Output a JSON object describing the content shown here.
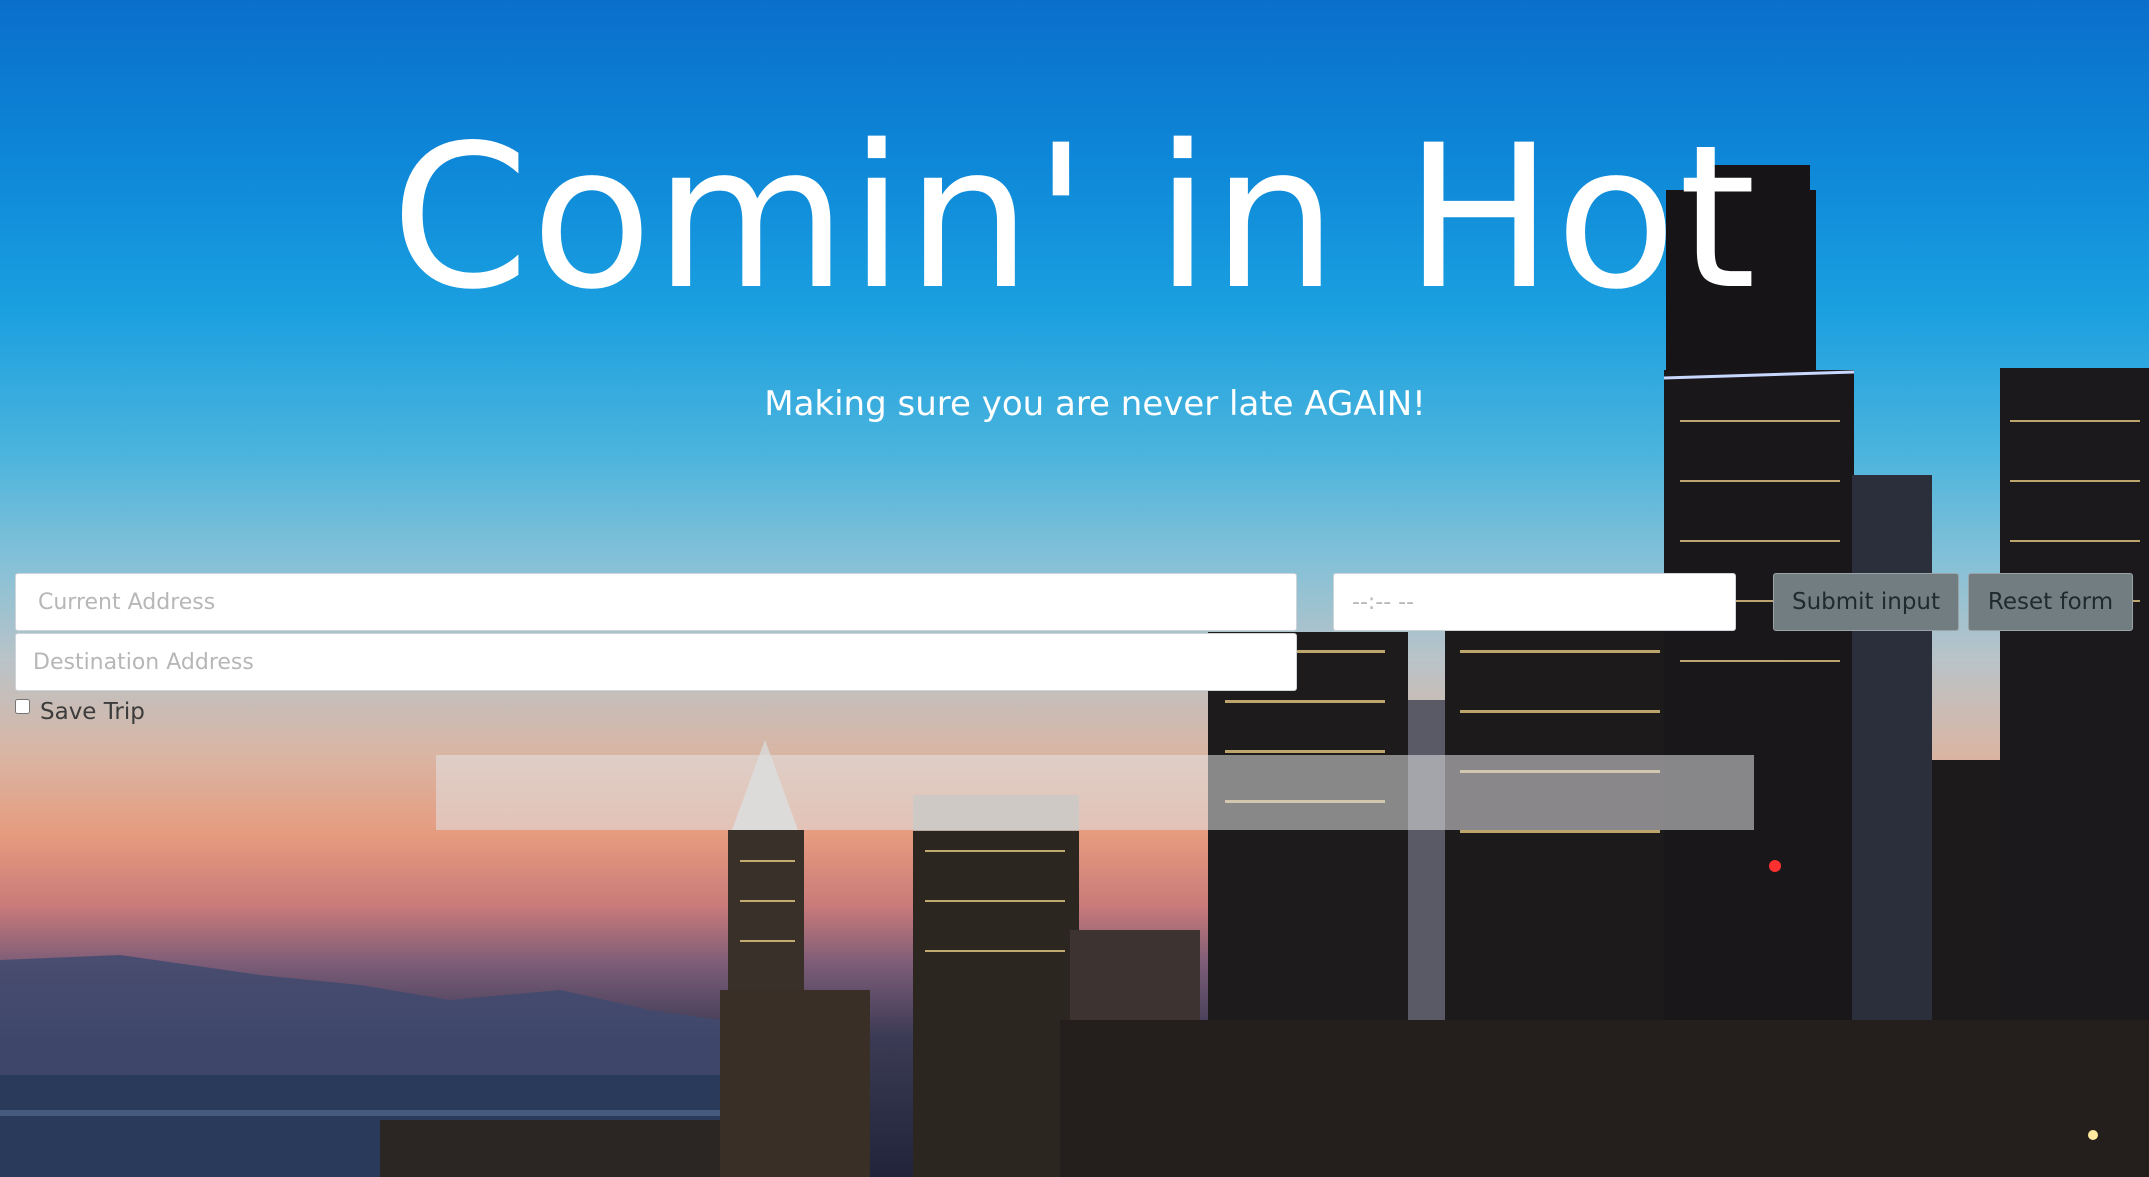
{
  "hero": {
    "title": "Comin' in Hot",
    "subtitle": "Making sure you are never late AGAIN!"
  },
  "form": {
    "current_address": {
      "placeholder": "Current Address",
      "value": ""
    },
    "destination_address": {
      "placeholder": "Destination Address",
      "value": ""
    },
    "time": {
      "value": "",
      "display": "--:-- --"
    },
    "submit_label": "Submit input",
    "reset_label": "Reset form",
    "save_trip_label": "Save Trip",
    "save_trip_checked": false
  },
  "result": {
    "text": ""
  },
  "colors": {
    "button_bg": "#727d82",
    "title_text": "#ffffff",
    "sky_top": "#0a6fcb",
    "sunset": "#e69b7e"
  }
}
